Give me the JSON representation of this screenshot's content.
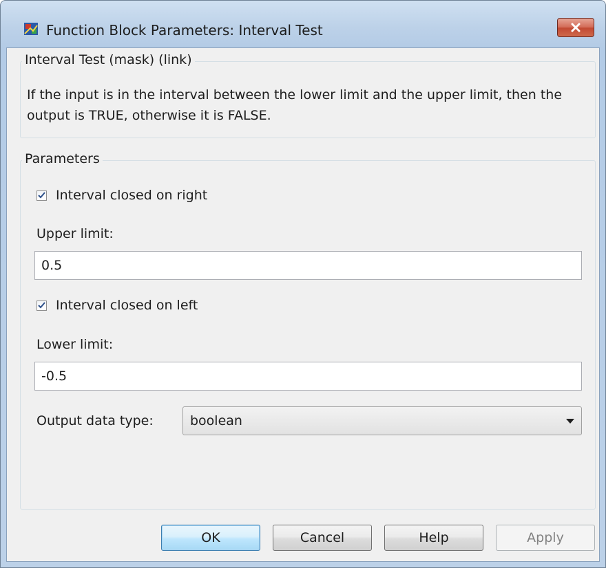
{
  "window": {
    "title": "Function Block Parameters: Interval Test",
    "icon": "simulink-block-icon",
    "close_icon": "close-icon"
  },
  "description": {
    "legend": "Interval Test (mask) (link)",
    "text": "If the input is in the interval between the lower limit and the upper limit, then the output is TRUE, otherwise it is FALSE."
  },
  "parameters": {
    "legend": "Parameters",
    "closed_right": {
      "label": "Interval closed on right",
      "checked": true
    },
    "upper_limit": {
      "label": "Upper limit:",
      "value": "0.5"
    },
    "closed_left": {
      "label": "Interval closed on left",
      "checked": true
    },
    "lower_limit": {
      "label": "Lower limit:",
      "value": "-0.5"
    },
    "output_type": {
      "label": "Output data type:",
      "value": "boolean"
    }
  },
  "buttons": {
    "ok": "OK",
    "cancel": "Cancel",
    "help": "Help",
    "apply": "Apply"
  }
}
